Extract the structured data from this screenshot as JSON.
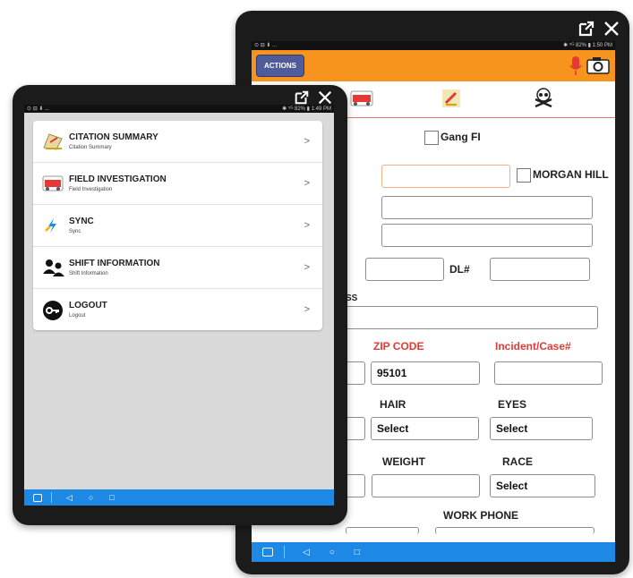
{
  "back_screen": {
    "status_left": "⊙ ⊟ ⬇ ...",
    "status_right": "✱ ⁵ᴳ 82% ▮ 1:50 PM",
    "actions_label": "ACTIONS",
    "form": {
      "gang_fi_label": "Gang FI",
      "morgan_hill_label": "MORGAN HILL",
      "dl_label": "DL#",
      "address_label_fragment": "SS",
      "zip_code_label": "ZIP CODE",
      "zip_code_value": "95101",
      "incident_label": "Incident/Case#",
      "hair_label": "HAIR",
      "hair_value": "Select",
      "eyes_label": "EYES",
      "eyes_value": "Select",
      "weight_label": "WEIGHT",
      "race_label": "RACE",
      "race_value": "Select",
      "work_phone_label": "WORK PHONE"
    }
  },
  "front_screen": {
    "status_left": "⊙ ⊟ ⬇ ...",
    "status_right": "✱ ⁵ᴳ 82% ▮ 1:49 PM",
    "menu": [
      {
        "title": "CITATION SUMMARY",
        "subtitle": "Citation Summary",
        "icon": "citation-icon"
      },
      {
        "title": "FIELD INVESTIGATION",
        "subtitle": "Field Investigation",
        "icon": "field-investigation-icon"
      },
      {
        "title": "SYNC",
        "subtitle": "Sync",
        "icon": "sync-icon"
      },
      {
        "title": "SHIFT INFORMATION",
        "subtitle": "Shift Information",
        "icon": "shift-icon"
      },
      {
        "title": "LOGOUT",
        "subtitle": "Logout",
        "icon": "logout-icon"
      }
    ],
    "chevron": ">"
  },
  "nav": {
    "back": "◁",
    "home": "○",
    "recent": "□"
  },
  "colors": {
    "accent_orange": "#f7941d",
    "nav_blue": "#1e88e5",
    "required_red": "#e53935"
  }
}
